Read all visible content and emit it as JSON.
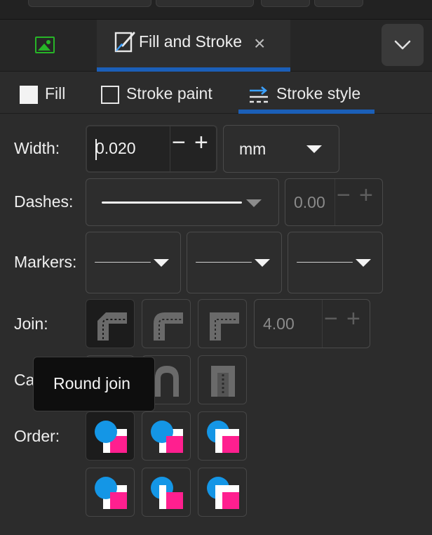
{
  "dock": {
    "tab_title": "Fill and Stroke",
    "close_glyph": "×"
  },
  "subtabs": {
    "fill": "Fill",
    "stroke_paint": "Stroke paint",
    "stroke_style": "Stroke style"
  },
  "width": {
    "label": "Width:",
    "value": "0.020",
    "unit": "mm"
  },
  "dashes": {
    "label": "Dashes:",
    "offset": "0.00"
  },
  "markers": {
    "label": "Markers:"
  },
  "join": {
    "label": "Join:",
    "miter_limit": "4.00",
    "options": [
      "bevel-join",
      "round-join",
      "miter-join"
    ]
  },
  "cap": {
    "label": "Cap:"
  },
  "order": {
    "label": "Order:"
  },
  "tooltip": {
    "text": "Round join"
  },
  "colors": {
    "accent": "#1b5fb8",
    "order_circle": "#1496e6",
    "order_square": "#ff1f8f",
    "image_icon": "#27b527"
  }
}
